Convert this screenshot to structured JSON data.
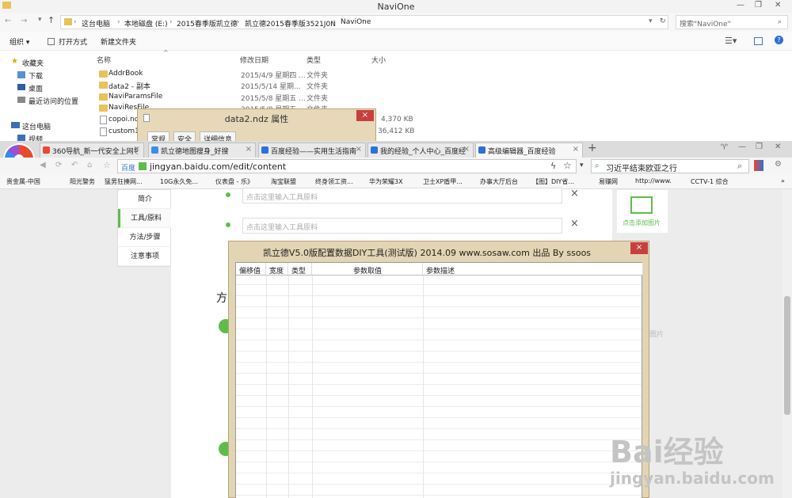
{
  "explorer": {
    "title": "NaviOne",
    "breadcrumb": [
      "这台电脑",
      "本地磁盘 (E:)",
      "2015春季版凯立德",
      "凯立德2015春季版3521J0N",
      "NaviOne"
    ],
    "search_placeholder": "搜索\"NaviOne\"",
    "toolbar": {
      "organize": "组织 ▾",
      "open_with": "打开方式",
      "new_folder": "新建文件夹"
    },
    "nav": {
      "favorites": "收藏夹",
      "downloads": "下载",
      "desktop": "桌面",
      "recent": "最近访问的位置",
      "this_pc": "这台电脑",
      "videos": "视频"
    },
    "columns": {
      "name": "名称",
      "date": "修改日期",
      "type": "类型",
      "size": "大小"
    },
    "files": [
      {
        "name": "AddrBook",
        "date": "2015/4/9 星期四 ...",
        "type": "文件夹",
        "size": ""
      },
      {
        "name": "data2 - 副本",
        "date": "2015/5/14 星期...",
        "type": "文件夹",
        "size": ""
      },
      {
        "name": "NaviParamsFile",
        "date": "2015/5/8 星期五 ...",
        "type": "文件夹",
        "size": ""
      },
      {
        "name": "NaviResFile",
        "date": "2015/5/8 星期五 ...",
        "type": "文件夹",
        "size": ""
      },
      {
        "name": "copoi.nd",
        "date": "",
        "type": "",
        "size": "4,370 KB"
      },
      {
        "name": "custom1.",
        "date": "",
        "type": "",
        "size": "36,412 KB"
      }
    ]
  },
  "props_dialog": {
    "title": "data2.ndz 属性",
    "close": "×",
    "tabs": [
      "常规",
      "安全",
      "详细信息"
    ]
  },
  "browser": {
    "tabs": [
      {
        "label": "360导航_新一代安全上网导",
        "close": "×",
        "color": "#e84a2f"
      },
      {
        "label": "凯立德地图瘦身_好搜",
        "close": "×",
        "color": "#3a8ee6"
      },
      {
        "label": "百度经验——实用生活指南",
        "close": "×",
        "color": "#2f6fd8"
      },
      {
        "label": "我的经验_个人中心_百度经",
        "close": "×",
        "color": "#2f6fd8"
      },
      {
        "label": "高级编辑器_百度经验",
        "close": "×",
        "color": "#2f6fd8"
      }
    ],
    "new_tab": "+",
    "url_site": "百度",
    "url": "jingyan.baidu.com/edit/content",
    "search_text": "习近平结束欧亚之行",
    "bookmarks": [
      "贵金属-中国",
      "阳光警务",
      "猛男狂揍网...",
      "10G永久免...",
      "仪表盘 - 乐》",
      "淘宝联盟",
      "终身领工资...",
      "华为荣耀3X",
      "卫士XP盾甲...",
      "办事大厅后台",
      "【图】DIY省...",
      "易赚网",
      "http://www.",
      "CCTV-1 综合"
    ]
  },
  "page": {
    "side_nav": [
      "简介",
      "工具/原料",
      "方法/步骤",
      "注意事项"
    ],
    "tool_placeholder_1": "点击这里输入工具原料",
    "tool_placeholder_2": "点击这里输入工具原料",
    "remove": "×",
    "add_image": "点击添加图片",
    "section_char": "方",
    "side_hint": "图片"
  },
  "diy_tool": {
    "title": "凯立德V5.0版配置数据DIY工具(测试版) 2014.09  www.sosaw.com 出品 By ssoos",
    "close": "×",
    "columns": [
      "偏移值",
      "宽度",
      "类型",
      "参数取值",
      "参数描述"
    ]
  },
  "watermark": {
    "brand": "Bai经验",
    "url": "jingyan.baidu.com"
  }
}
